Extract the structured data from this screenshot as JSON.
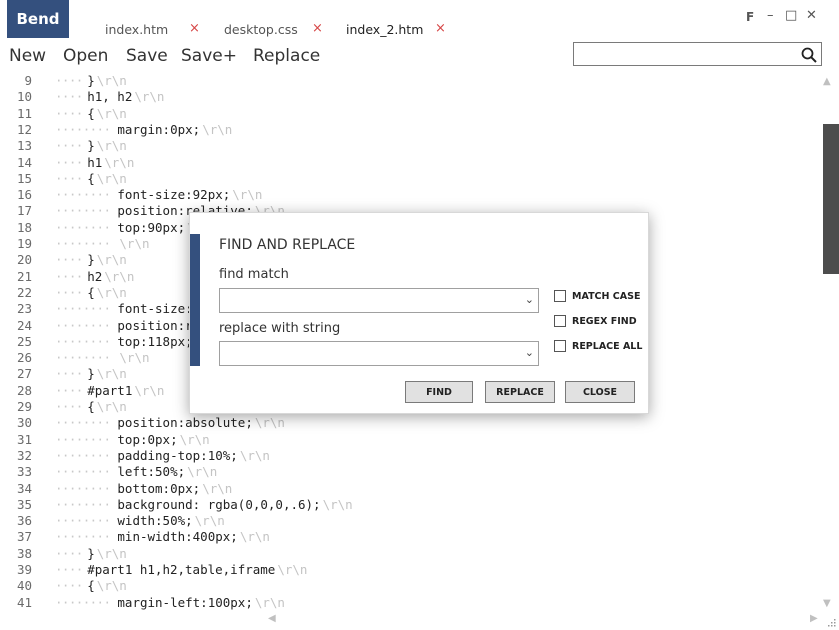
{
  "app": {
    "logo": "Bend"
  },
  "tabs": [
    {
      "label": "index.htm",
      "close": "×"
    },
    {
      "label": "desktop.css",
      "close": "×"
    },
    {
      "label": "index_2.htm",
      "close": "×"
    }
  ],
  "window": {
    "f_label": "F",
    "minimize": "–",
    "maximize": "□",
    "close": "✕"
  },
  "menu": {
    "new": "New",
    "open": "Open",
    "save": "Save",
    "save_plus": "Save+",
    "replace": "Replace"
  },
  "search": {
    "value": "",
    "placeholder": ""
  },
  "editor": {
    "eol_marker": "\\r\\n",
    "lines": [
      {
        "n": "9",
        "indent": "····",
        "code": "}"
      },
      {
        "n": "10",
        "indent": "····",
        "code": "h1, h2"
      },
      {
        "n": "11",
        "indent": "····",
        "code": "{"
      },
      {
        "n": "12",
        "indent": "········",
        "code": "margin:0px;"
      },
      {
        "n": "13",
        "indent": "····",
        "code": "}"
      },
      {
        "n": "14",
        "indent": "····",
        "code": "h1"
      },
      {
        "n": "15",
        "indent": "····",
        "code": "{"
      },
      {
        "n": "16",
        "indent": "········",
        "code": "font-size:92px;"
      },
      {
        "n": "17",
        "indent": "········",
        "code": "position:relative;"
      },
      {
        "n": "18",
        "indent": "········",
        "code": "top:90px;"
      },
      {
        "n": "19",
        "indent": "········",
        "code": ""
      },
      {
        "n": "20",
        "indent": "····",
        "code": "}"
      },
      {
        "n": "21",
        "indent": "····",
        "code": "h2"
      },
      {
        "n": "22",
        "indent": "····",
        "code": "{"
      },
      {
        "n": "23",
        "indent": "········",
        "code": "font-size:"
      },
      {
        "n": "24",
        "indent": "········",
        "code": "position:r"
      },
      {
        "n": "25",
        "indent": "········",
        "code": "top:118px;"
      },
      {
        "n": "26",
        "indent": "········",
        "code": ""
      },
      {
        "n": "27",
        "indent": "····",
        "code": "}"
      },
      {
        "n": "28",
        "indent": "····",
        "code": "#part1"
      },
      {
        "n": "29",
        "indent": "····",
        "code": "{"
      },
      {
        "n": "30",
        "indent": "········",
        "code": "position:absolute;"
      },
      {
        "n": "31",
        "indent": "········",
        "code": "top:0px;"
      },
      {
        "n": "32",
        "indent": "········",
        "code": "padding-top:10%;"
      },
      {
        "n": "33",
        "indent": "········",
        "code": "left:50%;"
      },
      {
        "n": "34",
        "indent": "········",
        "code": "bottom:0px;"
      },
      {
        "n": "35",
        "indent": "········",
        "code": "background: rgba(0,0,0,.6);"
      },
      {
        "n": "36",
        "indent": "········",
        "code": "width:50%;"
      },
      {
        "n": "37",
        "indent": "········",
        "code": "min-width:400px;"
      },
      {
        "n": "38",
        "indent": "····",
        "code": "}"
      },
      {
        "n": "39",
        "indent": "····",
        "code": "#part1 h1,h2,table,iframe"
      },
      {
        "n": "40",
        "indent": "····",
        "code": "{"
      },
      {
        "n": "41",
        "indent": "········",
        "code": "margin-left:100px;"
      }
    ]
  },
  "dialog": {
    "title": "FIND AND REPLACE",
    "find_label": "find match",
    "find_value": "",
    "replace_label": "replace with string",
    "replace_value": "",
    "options": [
      {
        "label": "MATCH CASE",
        "checked": false
      },
      {
        "label": "REGEX FIND",
        "checked": false
      },
      {
        "label": "REPLACE ALL",
        "checked": false
      }
    ],
    "buttons": {
      "find": "FIND",
      "replace": "REPLACE",
      "close": "CLOSE"
    }
  },
  "colors": {
    "accent": "#34507e",
    "tab_close": "#d64545",
    "scroll_thumb": "#4d4d4d"
  }
}
